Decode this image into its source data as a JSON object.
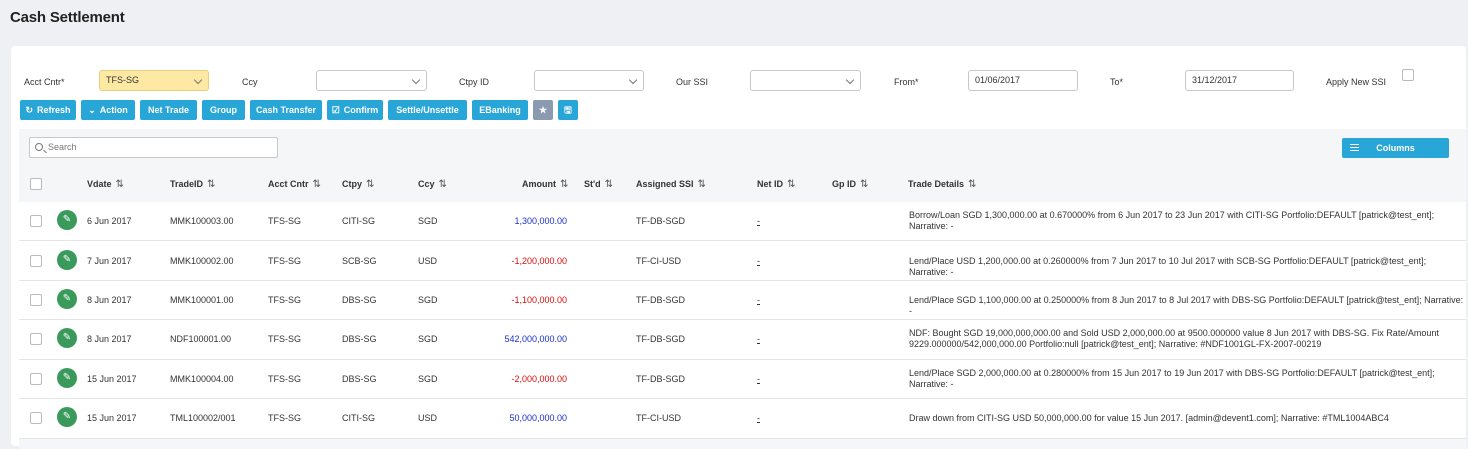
{
  "page": {
    "title": "Cash Settlement"
  },
  "filters": {
    "acct_cntr": {
      "label": "Acct Cntr*",
      "value": "TFS-SG"
    },
    "ccy": {
      "label": "Ccy",
      "value": ""
    },
    "ctpy_id": {
      "label": "Ctpy ID",
      "value": ""
    },
    "our_ssi": {
      "label": "Our SSI",
      "value": ""
    },
    "from": {
      "label": "From*",
      "value": "01/06/2017"
    },
    "to": {
      "label": "To*",
      "value": "31/12/2017"
    },
    "apply_new_ssi": {
      "label": "Apply New SSI",
      "checked": false
    }
  },
  "toolbar": {
    "refresh": "Refresh",
    "action": "Action",
    "net_trade": "Net Trade",
    "group": "Group",
    "cash_transfer": "Cash Transfer",
    "confirm": "Confirm",
    "settle_unsettle": "Settle/Unsettle",
    "ebanking": "EBanking"
  },
  "grid": {
    "search_placeholder": "Search",
    "columns_label": "Columns",
    "headers": {
      "vdate": "Vdate",
      "trade_id": "TradeID",
      "acct_cntr": "Acct Cntr",
      "ctpy": "Ctpy",
      "ccy": "Ccy",
      "amount": "Amount",
      "stld": "St'd",
      "assigned_ssi": "Assigned SSI",
      "net_id": "Net ID",
      "gp_id": "Gp ID",
      "trade_details": "Trade Details"
    },
    "sort_glyph": "⇅",
    "rows": [
      {
        "vdate": "6 Jun 2017",
        "trade_id": "MMK100003.00",
        "acct_cntr": "TFS-SG",
        "ctpy": "CITI-SG",
        "ccy": "SGD",
        "amount": "1,300,000.00",
        "ssi": "TF-DB-SGD",
        "net_id": "-",
        "details": "Borrow/Loan SGD 1,300,000.00 at 0.670000% from 6 Jun 2017 to 23 Jun 2017 with CITI-SG Portfolio:DEFAULT [patrick@test_ent]; Narrative: -"
      },
      {
        "vdate": "7 Jun 2017",
        "trade_id": "MMK100002.00",
        "acct_cntr": "TFS-SG",
        "ctpy": "SCB-SG",
        "ccy": "USD",
        "amount": "-1,200,000.00",
        "ssi": "TF-CI-USD",
        "net_id": "-",
        "details": "Lend/Place USD 1,200,000.00 at 0.260000% from 7 Jun 2017 to 10 Jul 2017 with SCB-SG Portfolio:DEFAULT [patrick@test_ent]; Narrative: -"
      },
      {
        "vdate": "8 Jun 2017",
        "trade_id": "MMK100001.00",
        "acct_cntr": "TFS-SG",
        "ctpy": "DBS-SG",
        "ccy": "SGD",
        "amount": "-1,100,000.00",
        "ssi": "TF-DB-SGD",
        "net_id": "-",
        "details": "Lend/Place SGD 1,100,000.00 at 0.250000% from 8 Jun 2017 to 8 Jul 2017 with DBS-SG Portfolio:DEFAULT [patrick@test_ent]; Narrative: -"
      },
      {
        "vdate": "8 Jun 2017",
        "trade_id": "NDF100001.00",
        "acct_cntr": "TFS-SG",
        "ctpy": "DBS-SG",
        "ccy": "SGD",
        "amount": "542,000,000.00",
        "ssi": "TF-DB-SGD",
        "net_id": "-",
        "details": "NDF: Bought SGD 19,000,000,000.00 and Sold USD 2,000,000.00 at 9500.000000 value 8 Jun 2017 with DBS-SG. Fix Rate/Amount 9229.000000/542,000,000.00 Portfolio:null [patrick@test_ent]; Narrative: #NDF1001GL-FX-2007-00219"
      },
      {
        "vdate": "15 Jun 2017",
        "trade_id": "MMK100004.00",
        "acct_cntr": "TFS-SG",
        "ctpy": "DBS-SG",
        "ccy": "SGD",
        "amount": "-2,000,000.00",
        "ssi": "TF-DB-SGD",
        "net_id": "-",
        "details": "Lend/Place SGD 2,000,000.00 at 0.280000% from 15 Jun 2017 to 19 Jun 2017 with DBS-SG Portfolio:DEFAULT [patrick@test_ent]; Narrative: -"
      },
      {
        "vdate": "15 Jun 2017",
        "trade_id": "TML100002/001",
        "acct_cntr": "TFS-SG",
        "ctpy": "CITI-SG",
        "ccy": "USD",
        "amount": "50,000,000.00",
        "ssi": "TF-CI-USD",
        "net_id": "-",
        "details": "Draw down from CITI-SG USD 50,000,000.00 for value 15 Jun 2017. [admin@devent1.com]; Narrative: #TML1004ABC4"
      }
    ]
  }
}
